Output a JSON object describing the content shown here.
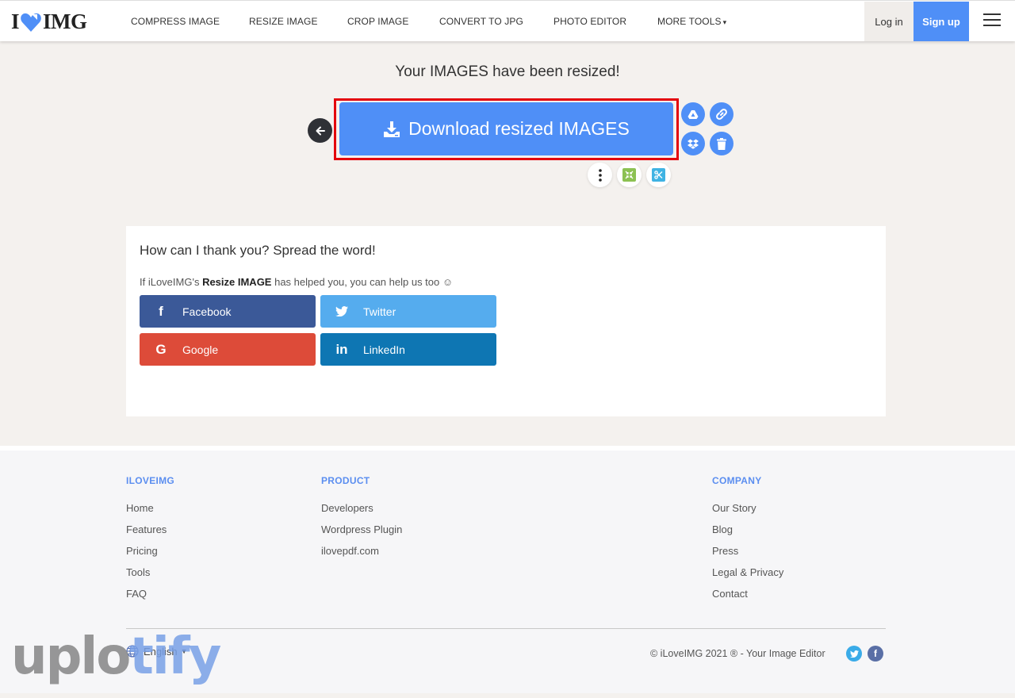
{
  "header": {
    "logo_text_left": "I",
    "logo_text_right": "IMG",
    "nav": [
      {
        "label": "COMPRESS IMAGE"
      },
      {
        "label": "RESIZE IMAGE"
      },
      {
        "label": "CROP IMAGE"
      },
      {
        "label": "CONVERT TO JPG"
      },
      {
        "label": "PHOTO EDITOR"
      },
      {
        "label": "MORE TOOLS",
        "caret": "▾"
      }
    ],
    "login_label": "Log in",
    "signup_label": "Sign up",
    "icons": {
      "logo": "heart-logo-icon",
      "menu": "hamburger-menu-icon"
    }
  },
  "main": {
    "title": "Your IMAGES have been resized!",
    "download_label": "Download resized IMAGES",
    "icons": {
      "back": "arrow-left-icon",
      "download": "download-icon",
      "drive": "google-drive-icon",
      "link": "link-icon",
      "dropbox": "dropbox-icon",
      "delete": "trash-icon",
      "more": "more-vertical-icon",
      "compress": "compress-icon",
      "crop": "scissors-icon"
    },
    "colors": {
      "accent": "#4f8ff7",
      "highlight": "#e3000b"
    }
  },
  "share": {
    "title": "How can I thank you? Spread the word!",
    "sub_prefix": "If iLoveIMG's ",
    "sub_bold": "Resize IMAGE",
    "sub_suffix": " has helped you, you can help us too ☺",
    "buttons": [
      {
        "label": "Facebook",
        "icon": "f",
        "color": "#3b5998"
      },
      {
        "label": "Twitter",
        "icon": "twitter-bird",
        "color": "#55acee"
      },
      {
        "label": "Google",
        "icon": "G",
        "color": "#dd4b39"
      },
      {
        "label": "LinkedIn",
        "icon": "in",
        "color": "#0e76b3"
      }
    ]
  },
  "footer": {
    "columns": [
      {
        "heading": "ILOVEIMG",
        "links": [
          "Home",
          "Features",
          "Pricing",
          "Tools",
          "FAQ"
        ]
      },
      {
        "heading": "PRODUCT",
        "links": [
          "Developers",
          "Wordpress Plugin",
          "ilovepdf.com"
        ]
      },
      {
        "heading": "COMPANY",
        "links": [
          "Our Story",
          "Blog",
          "Press",
          "Legal & Privacy",
          "Contact"
        ]
      }
    ],
    "language": "English",
    "copyright": "© iLoveIMG 2021 ® - Your Image Editor",
    "social": {
      "twitter_glyph": "t",
      "facebook_glyph": "f"
    }
  },
  "watermark": {
    "part1": "uplo",
    "part2": "tify"
  }
}
